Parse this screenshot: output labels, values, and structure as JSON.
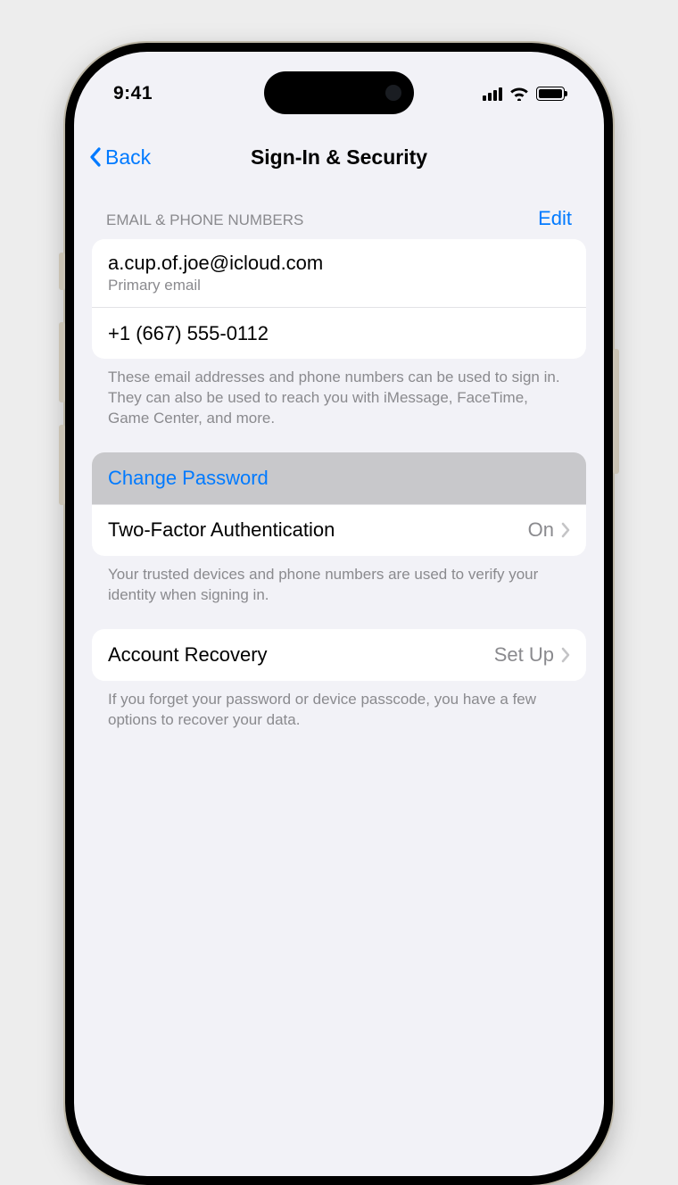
{
  "statusbar": {
    "time": "9:41"
  },
  "nav": {
    "back": "Back",
    "title": "Sign-In & Security"
  },
  "contacts": {
    "section_label": "Email & Phone Numbers",
    "edit": "Edit",
    "email": "a.cup.of.joe@icloud.com",
    "email_sub": "Primary email",
    "phone": "+1 (667) 555-0112",
    "footer": "These email addresses and phone numbers can be used to sign in. They can also be used to reach you with iMessage, FaceTime, Game Center, and more."
  },
  "security": {
    "change_password": "Change Password",
    "twofa_label": "Two-Factor Authentication",
    "twofa_value": "On",
    "footer": "Your trusted devices and phone numbers are used to verify your identity when signing in."
  },
  "recovery": {
    "label": "Account Recovery",
    "value": "Set Up",
    "footer": "If you forget your password or device passcode, you have a few options to recover your data."
  }
}
